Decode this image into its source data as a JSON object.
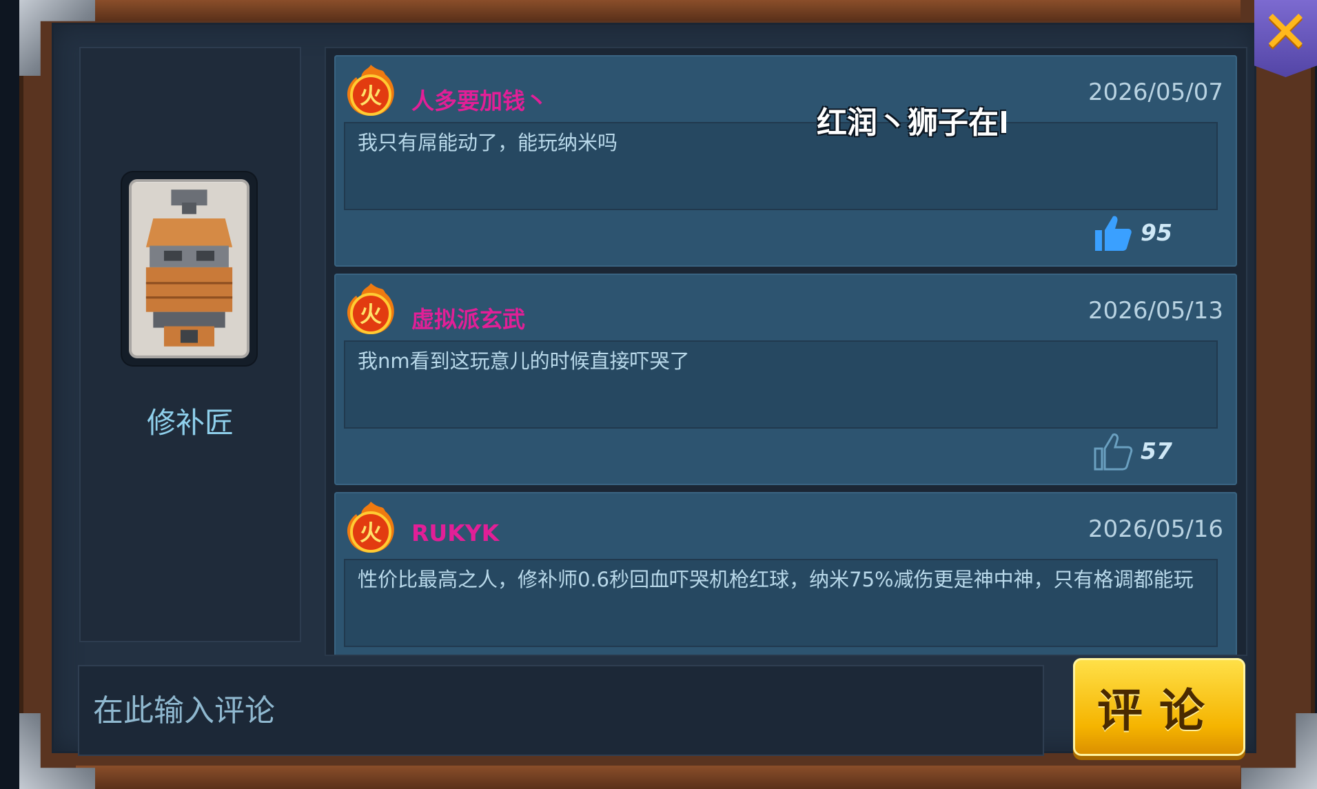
{
  "hero": {
    "name": "修补匠"
  },
  "comments": [
    {
      "user": "人多要加钱丶",
      "date": "2026/05/07",
      "text": "我只有屌能动了，能玩纳米吗",
      "likes": "95",
      "liked": true
    },
    {
      "user": "虚拟派玄武",
      "date": "2026/05/13",
      "text": "我nm看到这玩意儿的时候直接吓哭了",
      "likes": "57",
      "liked": false
    },
    {
      "user": "RUKYK",
      "date": "2026/05/16",
      "text": "性价比最高之人，修补师0.6秒回血吓哭机枪红球，纳米75%减伤更是神中神，只有格调都能玩",
      "likes": "",
      "liked": false
    }
  ],
  "badge_char": "火",
  "floating_danmaku": "红润丶狮子在I",
  "input": {
    "placeholder": "在此输入评论"
  },
  "buttons": {
    "comment": "评论",
    "close": "✕"
  },
  "colors": {
    "username": "#e21f97",
    "accent": "#f5b400",
    "card": "#2d5470"
  }
}
